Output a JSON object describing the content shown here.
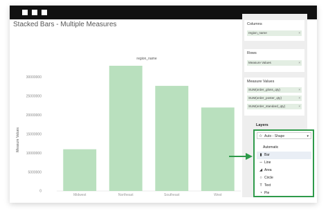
{
  "window": {
    "controls": [
      "window-dot-1",
      "window-dot-2",
      "window-dot-3"
    ]
  },
  "chart": {
    "title": "Stacked Bars - Multiple Measures"
  },
  "chart_data": {
    "type": "bar",
    "title": "Stacked Bars - Multiple Measures",
    "xlabel_top": "region_name",
    "ylabel": "Measure Values",
    "categories": [
      "Midwest",
      "Northeast",
      "Southeast",
      "West"
    ],
    "series": [
      {
        "values": [
          11000000,
          33000000,
          27700000,
          22000000
        ]
      }
    ],
    "ylim": [
      0,
      33000000
    ],
    "yticks": [
      {
        "value": 0,
        "label": "0"
      },
      {
        "value": 5000000,
        "label": "5000000"
      },
      {
        "value": 10000000,
        "label": "10000000"
      },
      {
        "value": 15000000,
        "label": "15000000"
      },
      {
        "value": 20000000,
        "label": "20000000"
      },
      {
        "value": 25000000,
        "label": "25000000"
      },
      {
        "value": 30000000,
        "label": "30000000"
      }
    ],
    "grid": false,
    "bar_color": "#b9e0be"
  },
  "sidebar": {
    "columns": {
      "title": "Columns",
      "pills": [
        "region_name"
      ]
    },
    "rows": {
      "title": "Rows",
      "pills": [
        "Measure Values"
      ]
    },
    "measure_values": {
      "title": "Measure Values",
      "pills": [
        "SUM(order_gloss_qty)",
        "SUM(order_poster_qty)",
        "SUM(order_standard_qty)"
      ]
    },
    "layers": {
      "title": "Layers",
      "selected": "Auto - Shape",
      "options": [
        {
          "label": "Automatic",
          "icon": ""
        },
        {
          "label": "Bar",
          "icon": "bar-chart-icon"
        },
        {
          "label": "Line",
          "icon": "line-chart-icon"
        },
        {
          "label": "Area",
          "icon": "area-chart-icon"
        },
        {
          "label": "Circle",
          "icon": "circle-icon"
        },
        {
          "label": "Text",
          "icon": "text-icon"
        },
        {
          "label": "Pie",
          "icon": "pie-chart-icon"
        }
      ],
      "highlighted_index": 1
    }
  },
  "colors": {
    "accent": "#2e9a4a",
    "pill_bg": "#e3eee3",
    "bar": "#b9e0be"
  }
}
